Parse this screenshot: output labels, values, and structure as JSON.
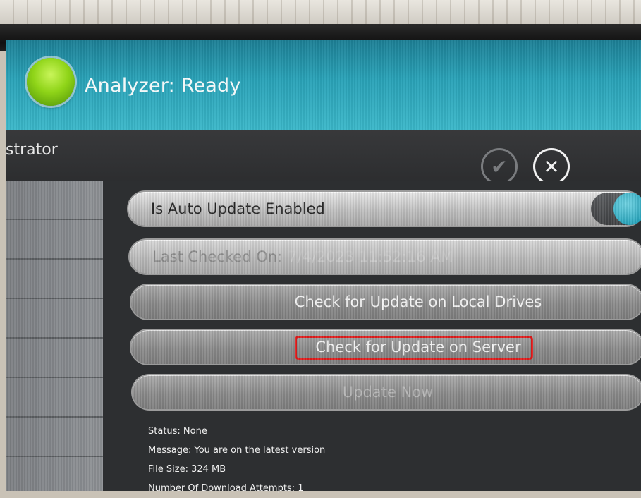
{
  "header": {
    "analyzer_label": "Analyzer:",
    "analyzer_status": "Ready",
    "status_color": "#8fd418"
  },
  "titlebar": {
    "title": "strator",
    "confirm_icon": "checkmark-icon",
    "close_icon": "close-icon"
  },
  "settings": {
    "auto_update_label": "Is Auto Update Enabled",
    "auto_update_enabled": true,
    "last_checked_label": "Last Checked On:",
    "last_checked_value": "7/4/2023 11:52:16 AM",
    "check_local_label": "Check for Update on Local Drives",
    "check_server_label": "Check for Update on Server",
    "update_now_label": "Update Now"
  },
  "status_info": {
    "status": "Status: None",
    "message": "Message: You are on the latest version",
    "file_size": "File Size: 324 MB",
    "download_attempts": "Number Of Download Attempts: 1"
  },
  "colors": {
    "header_accent": "#2aa3b8",
    "highlight": "#e01c1c"
  }
}
